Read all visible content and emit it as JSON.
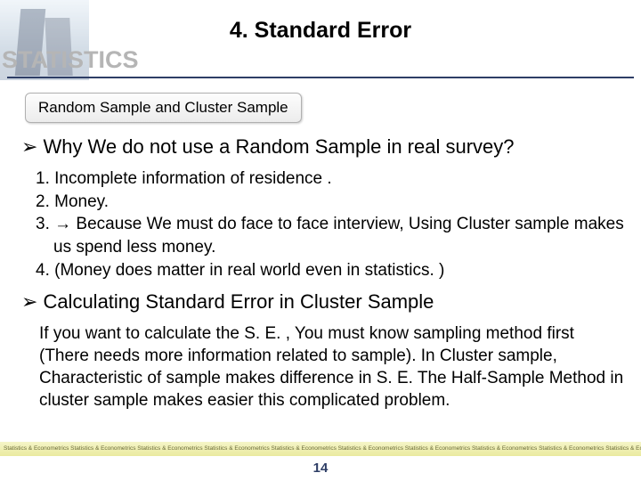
{
  "header": {
    "stats_label": "STATISTICS",
    "title": "4. Standard Error"
  },
  "pill": "Random Sample and Cluster Sample",
  "section1": {
    "heading": "Why We do not use a Random Sample in real survey?",
    "items": [
      "1.   Incomplete information of residence .",
      "2.   Money.",
      "3.       → Because We must do face to face interview, Using Cluster sample makes us spend less money.",
      "4.       (Money does matter in real world even in statistics. )"
    ]
  },
  "section2": {
    "heading": "Calculating Standard Error in Cluster Sample",
    "body": "If you want to calculate the S. E. , You must know sampling method first (There needs more information related to sample).  In Cluster sample, Characteristic of sample makes difference in S. E. The Half-Sample Method in cluster sample makes easier this complicated problem."
  },
  "footer": {
    "repeat": "Statistics & Econometrics Statistics & Econometrics Statistics & Econometrics Statistics & Econometrics Statistics & Econometrics Statistics & Econometrics Statistics & Econometrics Statistics & Econometrics Statistics & Econometrics Statistics & Econometrics",
    "page": "14"
  }
}
